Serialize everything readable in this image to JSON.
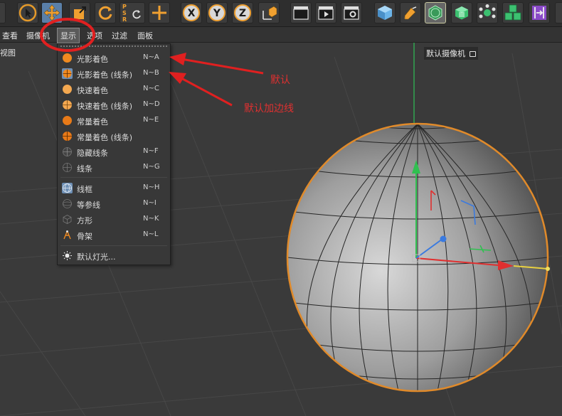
{
  "menubar": {
    "items": [
      "查看",
      "摄像机",
      "显示",
      "选项",
      "过滤",
      "面板"
    ]
  },
  "viewport": {
    "label": "视图",
    "camera_label": "默认摄像机"
  },
  "display_menu": {
    "items": [
      {
        "label": "光影着色",
        "shortcut": "N~A",
        "icon": "sphere-orange-icon"
      },
      {
        "label": "光影着色 (线条)",
        "shortcut": "N~B",
        "icon": "sphere-lines-icon",
        "selected": true
      },
      {
        "label": "快速着色",
        "shortcut": "N~C",
        "icon": "sphere-light-icon"
      },
      {
        "label": "快速着色 (线条)",
        "shortcut": "N~D",
        "icon": "sphere-light-lines-icon"
      },
      {
        "label": "常量着色",
        "shortcut": "N~E",
        "icon": "sphere-flat-icon"
      },
      {
        "label": "常量着色 (线条)",
        "shortcut": "",
        "icon": "sphere-flat-lines-icon"
      },
      {
        "label": "隐藏线条",
        "shortcut": "N~F",
        "icon": "hidden-lines-icon"
      },
      {
        "label": "线条",
        "shortcut": "N~G",
        "icon": "lines-icon"
      },
      {
        "label": "线框",
        "shortcut": "N~H",
        "icon": "wireframe-icon",
        "selected": true
      },
      {
        "label": "等参线",
        "shortcut": "N~I",
        "icon": "isoparm-icon"
      },
      {
        "label": "方形",
        "shortcut": "N~K",
        "icon": "box-icon"
      },
      {
        "label": "骨架",
        "shortcut": "N~L",
        "icon": "skeleton-icon"
      },
      {
        "label": "默认灯光...",
        "shortcut": "",
        "icon": "light-icon"
      }
    ]
  },
  "annotations": {
    "default": "默认",
    "default_edges": "默认加边线"
  },
  "toolbar": {
    "psr": [
      "P",
      "S",
      "R"
    ],
    "axes": [
      "X",
      "Y",
      "Z"
    ]
  },
  "colors": {
    "annotation_red": "#e03030",
    "selection_orange": "#e08a2a",
    "axis_x": "#e03030",
    "axis_y": "#30c050",
    "axis_z": "#3a7ae0"
  }
}
